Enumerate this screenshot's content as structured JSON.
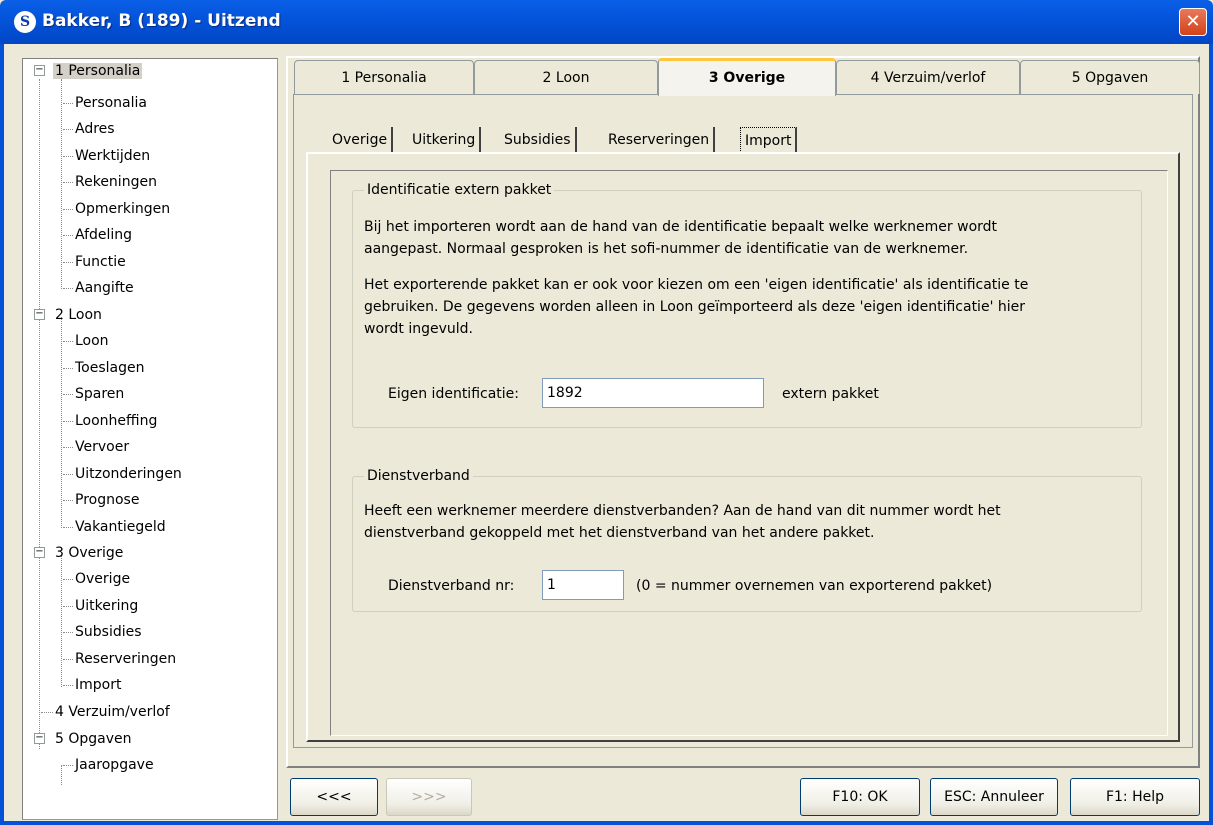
{
  "window": {
    "title": "Bakker, B (189) - Uitzend",
    "app_icon": "S",
    "close": "✕"
  },
  "tree": {
    "items": [
      {
        "label": "1 Personalia"
      },
      {
        "label": "Personalia"
      },
      {
        "label": "Adres"
      },
      {
        "label": "Werktijden"
      },
      {
        "label": "Rekeningen"
      },
      {
        "label": "Opmerkingen"
      },
      {
        "label": "Afdeling"
      },
      {
        "label": "Functie"
      },
      {
        "label": "Aangifte"
      },
      {
        "label": "2 Loon"
      },
      {
        "label": "Loon"
      },
      {
        "label": "Toeslagen"
      },
      {
        "label": "Sparen"
      },
      {
        "label": "Loonheffing"
      },
      {
        "label": "Vervoer"
      },
      {
        "label": "Uitzonderingen"
      },
      {
        "label": "Prognose"
      },
      {
        "label": "Vakantiegeld"
      },
      {
        "label": "3 Overige"
      },
      {
        "label": "Overige"
      },
      {
        "label": "Uitkering"
      },
      {
        "label": "Subsidies"
      },
      {
        "label": "Reserveringen"
      },
      {
        "label": "Import"
      },
      {
        "label": "4 Verzuim/verlof"
      },
      {
        "label": "5 Opgaven"
      },
      {
        "label": "Jaaropgave"
      }
    ],
    "expander_symbol": "−"
  },
  "tabs": [
    {
      "label": "1 Personalia"
    },
    {
      "label": "2 Loon"
    },
    {
      "label": "3 Overige"
    },
    {
      "label": "4 Verzuim/verlof"
    },
    {
      "label": "5 Opgaven"
    }
  ],
  "subtabs": [
    {
      "label": "Overige"
    },
    {
      "label": "Uitkering"
    },
    {
      "label": "Subsidies"
    },
    {
      "label": "Reserveringen"
    },
    {
      "label": "Import"
    }
  ],
  "identificatie": {
    "title": "Identificatie extern pakket",
    "para1_line1": "Bij het importeren wordt aan de hand van de identificatie bepaalt welke werknemer wordt",
    "para1_line2": "aangepast. Normaal gesproken is het sofi-nummer de identificatie van de werknemer.",
    "para2_line1": "Het exporterende pakket kan er ook voor kiezen om een 'eigen identificatie' als identificatie te",
    "para2_line2": "gebruiken. De gegevens worden alleen in Loon geïmporteerd als deze 'eigen identificatie' hier",
    "para2_line3": "wordt ingevuld.",
    "field_label": "Eigen identificatie:",
    "field_value": "1892",
    "field_suffix": "extern pakket"
  },
  "dienstverband": {
    "title": "Dienstverband",
    "para_line1": "Heeft een werknemer meerdere dienstverbanden? Aan de hand van dit nummer wordt het",
    "para_line2": "dienstverband gekoppeld met het dienstverband van het andere pakket.",
    "field_label": "Dienstverband nr:",
    "field_value": "1",
    "field_suffix": "(0 = nummer overnemen van exporterend pakket)"
  },
  "buttons": {
    "prev": "<<<",
    "next": ">>>",
    "ok": "F10: OK",
    "cancel": "ESC: Annuleer",
    "help": "F1: Help"
  }
}
